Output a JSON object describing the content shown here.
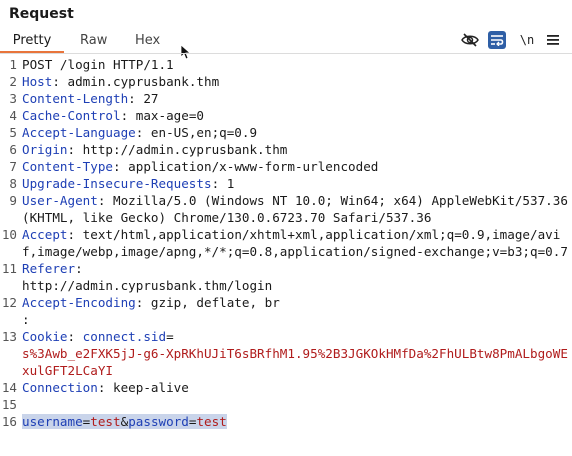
{
  "panel": {
    "title": "Request"
  },
  "tabs": [
    {
      "label": "Pretty",
      "active": true
    },
    {
      "label": "Raw",
      "active": false
    },
    {
      "label": "Hex",
      "active": false
    }
  ],
  "toolbar": {
    "eye_icon": "eye-slash-icon",
    "wrap_icon": "word-wrap-icon",
    "newline_label": "\\n",
    "menu_icon": "hamburger-menu-icon"
  },
  "colors": {
    "accent": "#e8743b",
    "header_name": "#1e3fb5",
    "value_red": "#b01c1c",
    "selection": "#c9d4ea"
  },
  "request": {
    "request_line": "POST /login HTTP/1.1",
    "headers": [
      {
        "num": "2",
        "name": "Host",
        "value": "admin.cyprusbank.thm"
      },
      {
        "num": "3",
        "name": "Content-Length",
        "value": "27"
      },
      {
        "num": "4",
        "name": "Cache-Control",
        "value": "max-age=0"
      },
      {
        "num": "5",
        "name": "Accept-Language",
        "value": "en-US,en;q=0.9"
      },
      {
        "num": "6",
        "name": "Origin",
        "value": "http://admin.cyprusbank.thm"
      },
      {
        "num": "7",
        "name": "Content-Type",
        "value": "application/x-www-form-urlencoded"
      },
      {
        "num": "8",
        "name": "Upgrade-Insecure-Requests",
        "value": "1"
      },
      {
        "num": "9",
        "name": "User-Agent",
        "value": "Mozilla/5.0 (Windows NT 10.0; Win64; x64) AppleWebKit/537.36 (KHTML, like Gecko) Chrome/130.0.6723.70 Safari/537.36"
      },
      {
        "num": "10",
        "name": "Accept",
        "value": "text/html,application/xhtml+xml,application/xml;q=0.9,image/avif,image/webp,image/apng,*/*;q=0.8,application/signed-exchange;v=b3;q=0.7"
      },
      {
        "num": "11",
        "name": "Referer",
        "value": "http://admin.cyprusbank.thm/login"
      },
      {
        "num": "12",
        "name": "Accept-Encoding",
        "value": "gzip, deflate, br"
      }
    ],
    "cookie": {
      "num": "13",
      "name": "Cookie",
      "cookie_name": "connect.sid",
      "cookie_value": "s%3Awb_e2FXK5jJ-g6-XpRKhUJiT6sBRfhM1.95%2B3JGKOkHMfDa%2FhULBtw8PmALbgoWExulGFT2LCaYI"
    },
    "connection": {
      "num": "14",
      "name": "Connection",
      "value": "keep-alive"
    },
    "blank_num": "15",
    "body": {
      "num": "16",
      "user_key": "username",
      "user_val": "test",
      "amp": "&",
      "pass_key": "password",
      "pass_val": "test"
    }
  }
}
